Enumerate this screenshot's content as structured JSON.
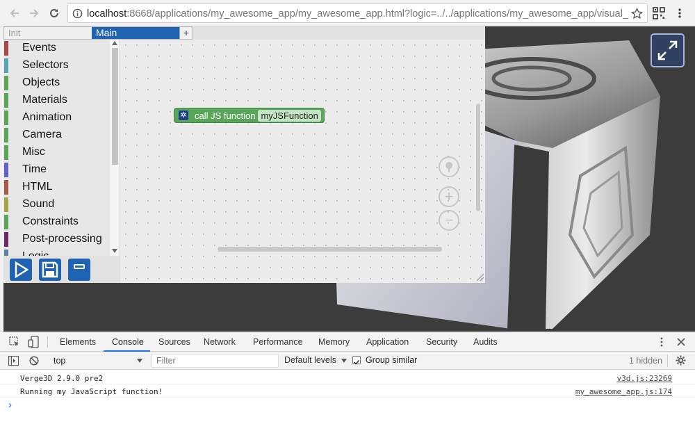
{
  "browser": {
    "url_host": "localhost",
    "url_rest": ":8668/applications/my_awesome_app/my_awesome_app.html?logic=../../applications/my_awesome_app/visual_..."
  },
  "editor": {
    "tabs": {
      "init": "Init",
      "main": "Main",
      "add": "+"
    },
    "categories": [
      {
        "label": "Events",
        "color": "#a54a4a"
      },
      {
        "label": "Selectors",
        "color": "#5aa5b5"
      },
      {
        "label": "Objects",
        "color": "#5ba55b"
      },
      {
        "label": "Materials",
        "color": "#5ba55b"
      },
      {
        "label": "Animation",
        "color": "#5ba55b"
      },
      {
        "label": "Camera",
        "color": "#5ba55b"
      },
      {
        "label": "Misc",
        "color": "#5ba55b"
      },
      {
        "label": "Time",
        "color": "#6262cc"
      },
      {
        "label": "HTML",
        "color": "#a55a4a"
      },
      {
        "label": "Sound",
        "color": "#a5a54a"
      },
      {
        "label": "Constraints",
        "color": "#5ba55b"
      },
      {
        "label": "Post-processing",
        "color": "#6a2a6a"
      },
      {
        "label": "Logic",
        "color": "#5b80a5"
      }
    ],
    "block": {
      "label": "call JS function",
      "field": "myJSFunction"
    }
  },
  "devtools": {
    "tabs": [
      "Elements",
      "Console",
      "Sources",
      "Network",
      "Performance",
      "Memory",
      "Application",
      "Security",
      "Audits"
    ],
    "active_tab": "Console",
    "context": "top",
    "filter_placeholder": "Filter",
    "levels": "Default levels",
    "group_similar": "Group similar",
    "hidden": "1 hidden",
    "messages": [
      {
        "text": "Verge3D 2.9.0 pre2",
        "source": "v3d.js:23269"
      },
      {
        "text": "Running my JavaScript function!",
        "source": "my_awesome_app.js:174"
      }
    ],
    "prompt": "›"
  },
  "colors": {
    "accent": "#1f63b2",
    "block_green": "#5ba55b",
    "devtools_blue": "#1a73e8"
  }
}
